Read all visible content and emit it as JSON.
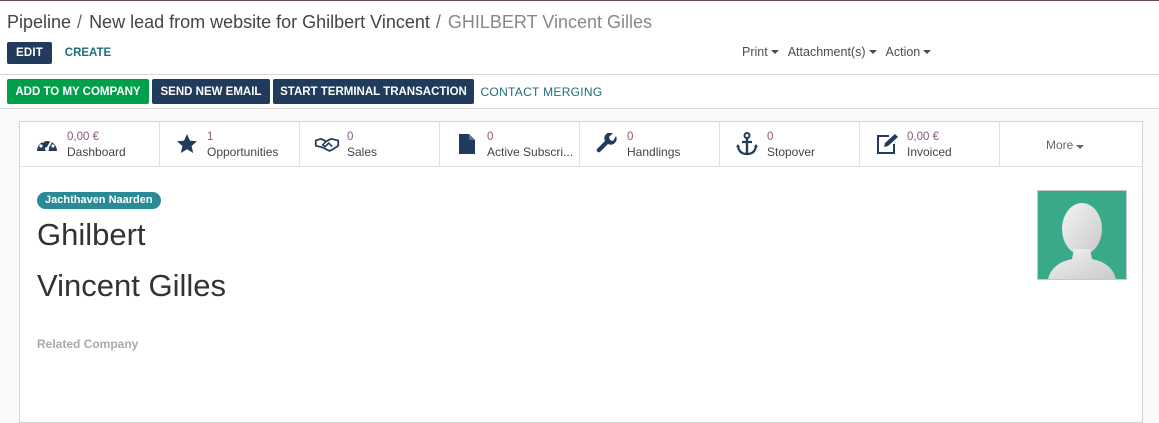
{
  "breadcrumb": {
    "items": [
      "Pipeline",
      "New lead from website for Ghilbert Vincent"
    ],
    "separator": "/",
    "active": "GHILBERT Vincent Gilles"
  },
  "toolbar": {
    "edit_label": "EDIT",
    "create_label": "CREATE",
    "print_label": "Print",
    "attachments_label": "Attachment(s)",
    "action_label": "Action"
  },
  "statusbar": {
    "add_company": "ADD TO MY COMPANY",
    "send_email": "SEND NEW EMAIL",
    "start_terminal": "START TERMINAL TRANSACTION",
    "contact_merging": "CONTACT MERGING"
  },
  "smart_buttons": [
    {
      "icon": "dashboard-icon",
      "value": "0,00 €",
      "label": "Dashboard"
    },
    {
      "icon": "star-icon",
      "value": "1",
      "label": "Opportunities"
    },
    {
      "icon": "handshake-icon",
      "value": "0",
      "label": "Sales"
    },
    {
      "icon": "document-icon",
      "value": "0",
      "label": "Active Subscri..."
    },
    {
      "icon": "wrench-icon",
      "value": "0",
      "label": "Handlings"
    },
    {
      "icon": "anchor-icon",
      "value": "0",
      "label": "Stopover"
    },
    {
      "icon": "edit-icon",
      "value": "0,00 €",
      "label": "Invoiced"
    }
  ],
  "more_label": "More",
  "record": {
    "tag": "Jachthaven Naarden",
    "first_name": "Ghilbert",
    "last_name": "Vincent Gilles",
    "related_company_label": "Related Company"
  },
  "colors": {
    "primary": "#213b5c",
    "success": "#00a04a",
    "link": "#1f6f79",
    "stat_value": "#875a7b",
    "tag": "#2a8a96",
    "avatar_bg": "#3aa98a"
  }
}
